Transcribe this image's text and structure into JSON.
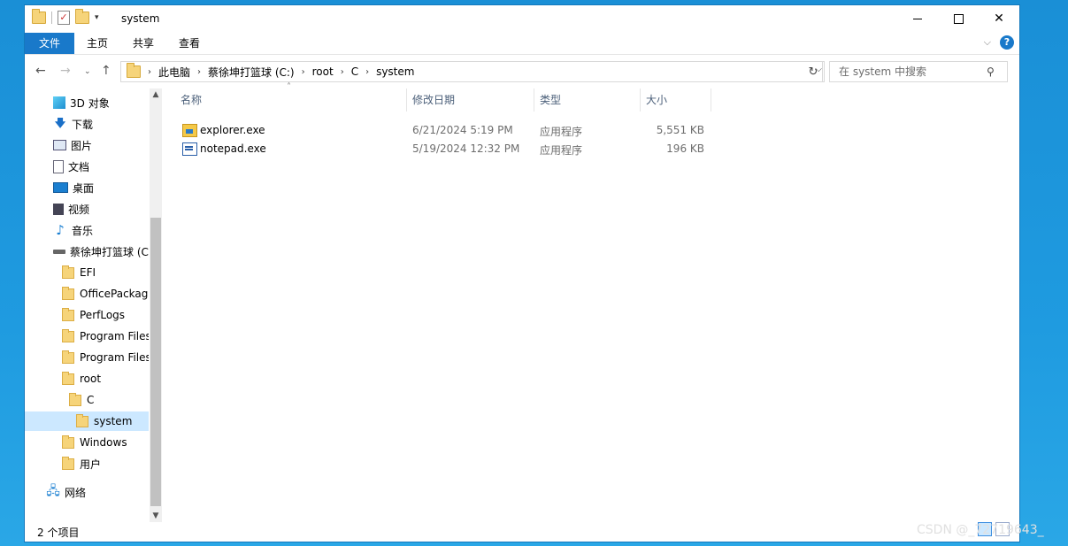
{
  "window": {
    "title": "system"
  },
  "ribbon": {
    "tabs": [
      "文件",
      "主页",
      "共享",
      "查看"
    ]
  },
  "address": {
    "crumbs": [
      "此电脑",
      "蔡徐坤打篮球 (C:)",
      "root",
      "C",
      "system"
    ],
    "search_placeholder": "在 system 中搜索"
  },
  "nav": {
    "items": [
      {
        "label": "3D 对象",
        "icon": "3d-objects-icon"
      },
      {
        "label": "下载",
        "icon": "download-icon"
      },
      {
        "label": "图片",
        "icon": "pictures-icon"
      },
      {
        "label": "文档",
        "icon": "documents-icon"
      },
      {
        "label": "桌面",
        "icon": "desktop-icon"
      },
      {
        "label": "视频",
        "icon": "videos-icon"
      },
      {
        "label": "音乐",
        "icon": "music-icon"
      },
      {
        "label": "蔡徐坤打篮球 (C",
        "icon": "drive-icon"
      },
      {
        "label": "EFI",
        "icon": "folder-icon"
      },
      {
        "label": "OfficePackage",
        "icon": "folder-icon"
      },
      {
        "label": "PerfLogs",
        "icon": "folder-icon"
      },
      {
        "label": "Program Files",
        "icon": "folder-icon"
      },
      {
        "label": "Program Files",
        "icon": "folder-icon"
      },
      {
        "label": "root",
        "icon": "folder-icon"
      },
      {
        "label": "C",
        "icon": "folder-icon"
      },
      {
        "label": "system",
        "icon": "folder-icon",
        "selected": true
      },
      {
        "label": "Windows",
        "icon": "folder-icon"
      },
      {
        "label": "用户",
        "icon": "folder-icon"
      },
      {
        "label": "网络",
        "icon": "network-icon"
      }
    ]
  },
  "list": {
    "columns": [
      "名称",
      "修改日期",
      "类型",
      "大小"
    ],
    "rows": [
      {
        "name": "explorer.exe",
        "date": "6/21/2024 5:19 PM",
        "type": "应用程序",
        "size": "5,551 KB",
        "icon": "explorer-app-icon"
      },
      {
        "name": "notepad.exe",
        "date": "5/19/2024 12:32 PM",
        "type": "应用程序",
        "size": "196 KB",
        "icon": "notepad-app-icon"
      }
    ]
  },
  "status": {
    "count": "2 个项目"
  },
  "watermark": "CSDN @_72719643_"
}
